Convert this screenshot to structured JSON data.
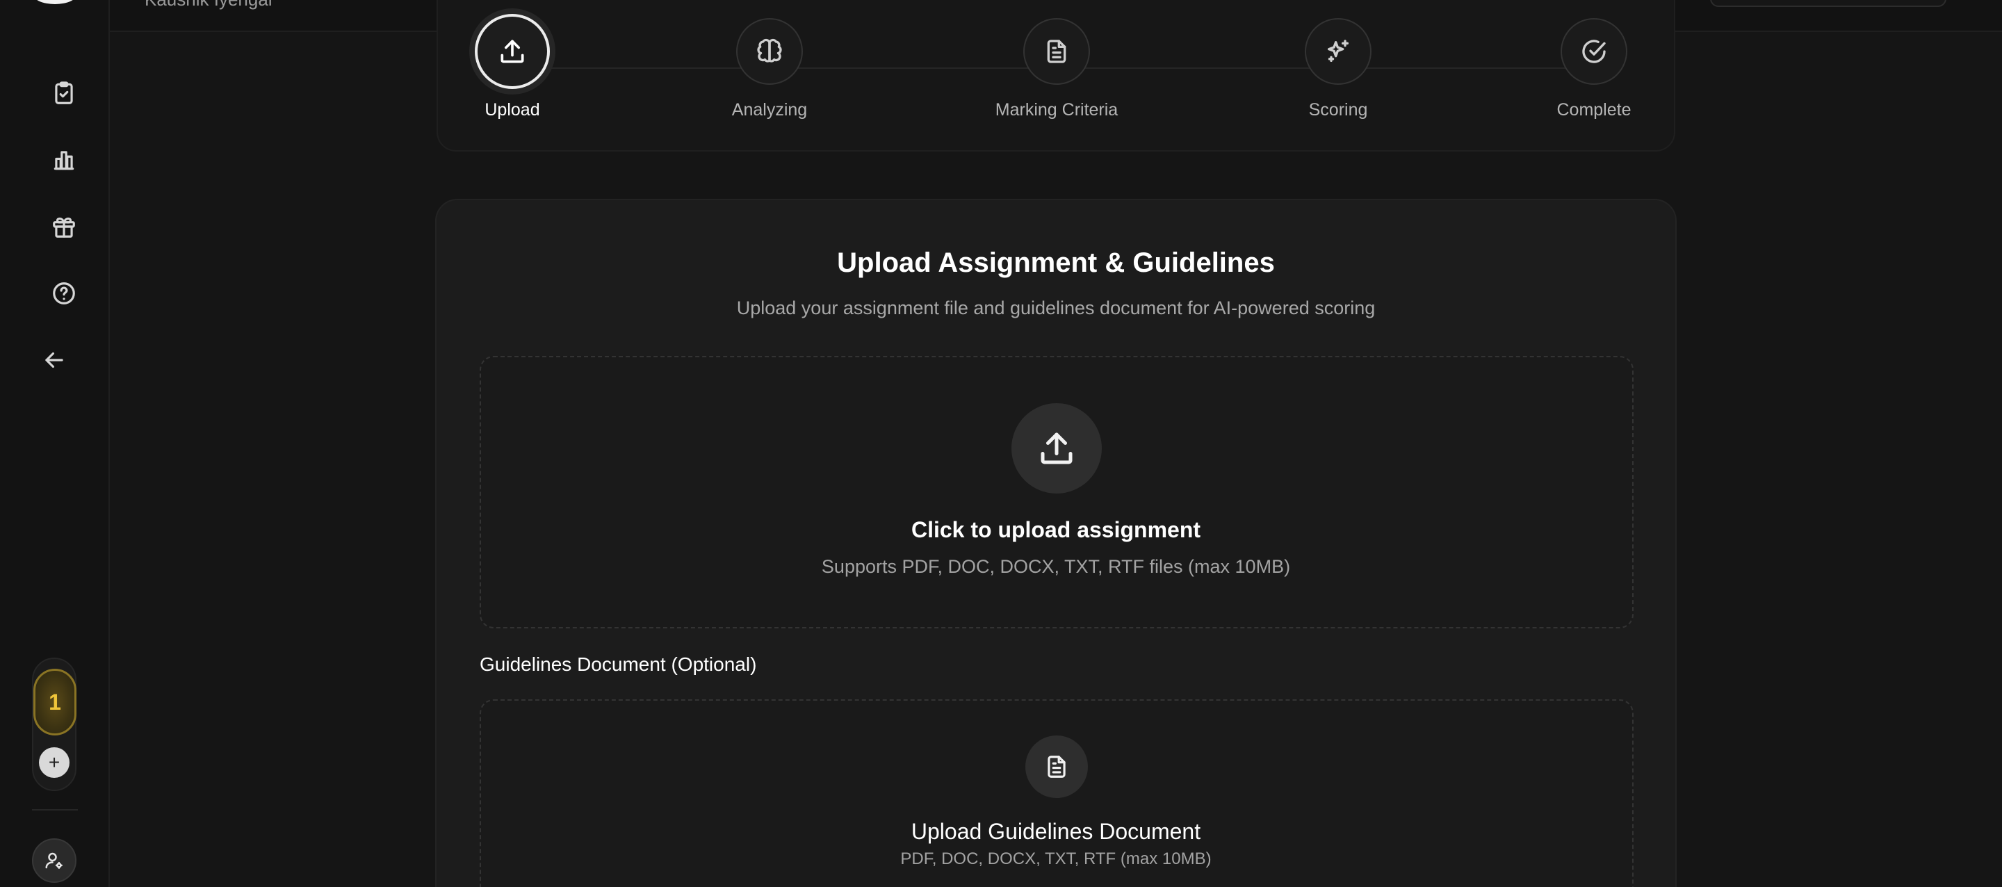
{
  "header": {
    "user_name": "Kaushik Iyengar"
  },
  "sidebar": {
    "items": [
      {
        "name": "assignments",
        "icon": "clipboard-check-icon"
      },
      {
        "name": "analytics",
        "icon": "bar-chart-icon"
      },
      {
        "name": "rewards",
        "icon": "gift-icon"
      },
      {
        "name": "help",
        "icon": "help-circle-icon"
      },
      {
        "name": "back",
        "icon": "arrow-left-icon"
      }
    ],
    "credits": "1",
    "add_label": "+"
  },
  "steps": [
    {
      "label": "Upload",
      "icon": "upload-icon",
      "active": true
    },
    {
      "label": "Analyzing",
      "icon": "brain-icon",
      "active": false
    },
    {
      "label": "Marking Criteria",
      "icon": "file-text-icon",
      "active": false
    },
    {
      "label": "Scoring",
      "icon": "sparkles-icon",
      "active": false
    },
    {
      "label": "Complete",
      "icon": "check-circle-icon",
      "active": false
    }
  ],
  "upload": {
    "title": "Upload Assignment & Guidelines",
    "subtitle": "Upload your assignment file and guidelines document for AI-powered scoring",
    "assignment": {
      "title": "Click to upload assignment",
      "note": "Supports PDF, DOC, DOCX, TXT, RTF files (max 10MB)"
    },
    "guidelines": {
      "section_label": "Guidelines Document (Optional)",
      "title": "Upload Guidelines Document",
      "note": "PDF, DOC, DOCX, TXT, RTF (max 10MB)"
    }
  },
  "colors": {
    "background": "#151515",
    "card": "#1c1c1c",
    "accent_gold": "#f0c53a",
    "text_primary": "#ffffff",
    "text_muted": "#a8a8a8"
  }
}
